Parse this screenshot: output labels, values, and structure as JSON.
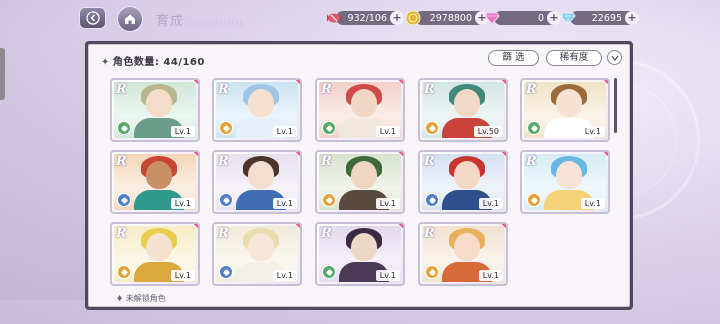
{
  "header": {
    "title": "育成",
    "resources": [
      {
        "name": "stamina",
        "icon": "candy-icon",
        "value": "932/106",
        "color": "#e0566b"
      },
      {
        "name": "gold",
        "icon": "coin-icon",
        "value": "2978800",
        "color": "#e3b43a"
      },
      {
        "name": "pink_gem",
        "icon": "pink-gem-icon",
        "value": "0",
        "color": "#e677c4"
      },
      {
        "name": "diamond",
        "icon": "diamond-icon",
        "value": "22695",
        "color": "#7cc7ef"
      }
    ],
    "plus_label": "+"
  },
  "panel": {
    "count_label": "角色数量: 44/160",
    "star_glyph": "✦",
    "filter_label": "篩 选",
    "rarity_label": "稀有度",
    "footer_hint": "♦ 未解锁角色"
  },
  "cards": [
    {
      "rarity": "R",
      "level": "Lv.1",
      "attr_color": "#5aa86a",
      "sky": "#cfe7d8",
      "hair": "#b9b58d",
      "skin": "#f4dcc8",
      "outfit": "#6a9e8a"
    },
    {
      "rarity": "R",
      "level": "Lv.1",
      "attr_color": "#e2a33b",
      "sky": "#cbe3f2",
      "hair": "#9fc6e6",
      "skin": "#f6e0d0",
      "outfit": "#e7eef5"
    },
    {
      "rarity": "R",
      "level": "Lv.1",
      "attr_color": "#5aa86a",
      "sky": "#f3d0c8",
      "hair": "#d24b4b",
      "skin": "#f2d6c4",
      "outfit": "#f1e6dc"
    },
    {
      "rarity": "R",
      "level": "Lv.50",
      "attr_color": "#e2a33b",
      "sky": "#d2e6e4",
      "hair": "#3f8a7a",
      "skin": "#f2d8c6",
      "outfit": "#c9433d"
    },
    {
      "rarity": "R",
      "level": "Lv.1",
      "attr_color": "#5aa86a",
      "sky": "#f0e2c6",
      "hair": "#9a6b3c",
      "skin": "#f6e2d2",
      "outfit": "#ffffff"
    },
    {
      "rarity": "R",
      "level": "Lv.1",
      "attr_color": "#4e7fc9",
      "sky": "#f3d6b7",
      "hair": "#c84535",
      "skin": "#c98f66",
      "outfit": "#2f9a8c"
    },
    {
      "rarity": "R",
      "level": "Lv.1",
      "attr_color": "#4e7fc9",
      "sky": "#e6e0ee",
      "hair": "#4a3328",
      "skin": "#f4ded0",
      "outfit": "#3f6cb3"
    },
    {
      "rarity": "R",
      "level": "Lv.1",
      "attr_color": "#e2a33b",
      "sky": "#d8e2cf",
      "hair": "#3d6a3a",
      "skin": "#f0d5c0",
      "outfit": "#5c4a3c"
    },
    {
      "rarity": "R",
      "level": "Lv.1",
      "attr_color": "#4e7fc9",
      "sky": "#d5e0f1",
      "hair": "#c8342f",
      "skin": "#f3d8c6",
      "outfit": "#2e4f8c"
    },
    {
      "rarity": "R",
      "level": "Lv.1",
      "attr_color": "#e2a33b",
      "sky": "#d6ecf4",
      "hair": "#68b7e3",
      "skin": "#f7e2d6",
      "outfit": "#f4d27a"
    },
    {
      "rarity": "R",
      "level": "Lv.1",
      "attr_color": "#e2a33b",
      "sky": "#f6ecc5",
      "hair": "#e8cd4e",
      "skin": "#f6e2cf",
      "outfit": "#d9a93d"
    },
    {
      "rarity": "R",
      "level": "Lv.1",
      "attr_color": "#4e7fc9",
      "sky": "#f1ead9",
      "hair": "#e9dcae",
      "skin": "#f7e6d8",
      "outfit": "#f2efe8"
    },
    {
      "rarity": "R",
      "level": "Lv.1",
      "attr_color": "#5aa86a",
      "sky": "#e3d9ec",
      "hair": "#3a2a44",
      "skin": "#efd7c8",
      "outfit": "#4b3a57"
    },
    {
      "rarity": "R",
      "level": "Lv.1",
      "attr_color": "#e2a33b",
      "sky": "#f1e0cf",
      "hair": "#e8b15c",
      "skin": "#f6dcc8",
      "outfit": "#d86a3a"
    }
  ]
}
